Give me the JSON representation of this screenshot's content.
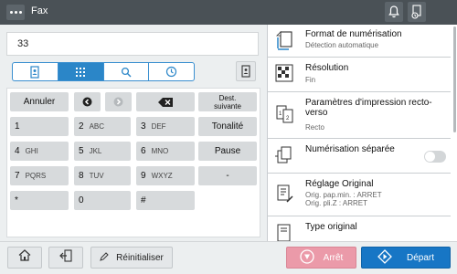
{
  "topbar": {
    "menu_icon": "more-dots-icon",
    "title": "Fax"
  },
  "destination": {
    "value": "33"
  },
  "tabs": [
    "address-book-icon",
    "keypad-icon",
    "search-icon",
    "history-icon"
  ],
  "keypad": {
    "cancel": "Annuler",
    "dest_next": "Dest.\nsuivante",
    "keys": [
      {
        "num": "1",
        "letters": ""
      },
      {
        "num": "2",
        "letters": "ABC"
      },
      {
        "num": "3",
        "letters": "DEF"
      },
      {
        "num": "4",
        "letters": "GHI"
      },
      {
        "num": "5",
        "letters": "JKL"
      },
      {
        "num": "6",
        "letters": "MNO"
      },
      {
        "num": "7",
        "letters": "PQRS"
      },
      {
        "num": "8",
        "letters": "TUV"
      },
      {
        "num": "9",
        "letters": "WXYZ"
      },
      {
        "num": "*",
        "letters": ""
      },
      {
        "num": "0",
        "letters": ""
      },
      {
        "num": "#",
        "letters": ""
      }
    ],
    "side": [
      "Tonalité",
      "Pause",
      "-"
    ]
  },
  "options": [
    {
      "label": "Format de numérisation",
      "value": "Détection automatique"
    },
    {
      "label": "Résolution",
      "value": "Fin"
    },
    {
      "label": "Paramètres d'impression recto-verso",
      "value": "Recto"
    },
    {
      "label": "Numérisation séparée",
      "value": ""
    },
    {
      "label": "Réglage Original",
      "value": "Orig. pap.min. : ARRET",
      "value2": "Orig. pli.Z : ARRET"
    },
    {
      "label": "Type original",
      "value": ""
    }
  ],
  "bottom": {
    "reset": "Réinitialiser",
    "stop": "Arrêt",
    "start": "Départ"
  }
}
